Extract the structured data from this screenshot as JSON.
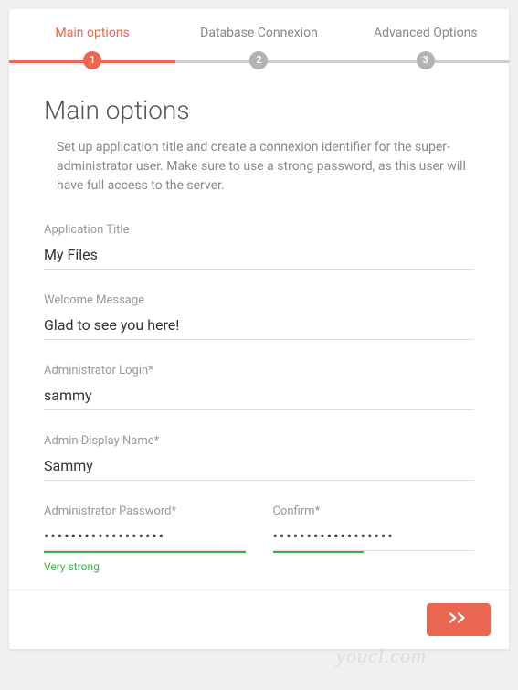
{
  "stepper": {
    "steps": [
      {
        "label": "Main options",
        "number": "1",
        "active": true
      },
      {
        "label": "Database Connexion",
        "number": "2",
        "active": false
      },
      {
        "label": "Advanced Options",
        "number": "3",
        "active": false
      }
    ]
  },
  "page": {
    "title": "Main options",
    "description": "Set up application title and create a connexion identifier for the super-administrator user. Make sure to use a strong password, as this user will have full access to the server."
  },
  "form": {
    "app_title": {
      "label": "Application Title",
      "value": "My Files"
    },
    "welcome": {
      "label": "Welcome Message",
      "value": "Glad to see you here!"
    },
    "admin_login": {
      "label": "Administrator Login*",
      "value": "sammy"
    },
    "admin_display": {
      "label": "Admin Display Name*",
      "value": "Sammy"
    },
    "admin_password": {
      "label": "Administrator Password*",
      "value": "••••••••••••••••••"
    },
    "confirm_password": {
      "label": "Confirm*",
      "value": "••••••••••••••••••"
    },
    "strength": {
      "label": "Very strong",
      "color": "#32b643"
    }
  },
  "watermark": "youcl.com"
}
